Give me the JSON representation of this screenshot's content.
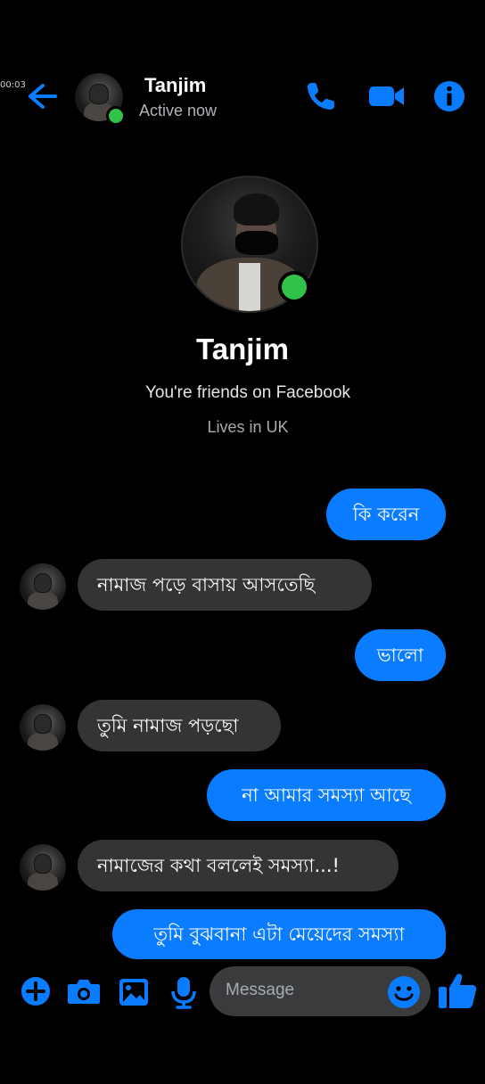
{
  "recording": {
    "timer": "00:03"
  },
  "header": {
    "name": "Tanjim",
    "status": "Active now",
    "icons": [
      "back-arrow-icon",
      "phone-icon",
      "video-camera-icon",
      "info-icon"
    ]
  },
  "profile": {
    "name": "Tanjim",
    "friends_text": "You're friends on Facebook",
    "lives_text": "Lives in UK"
  },
  "messages": [
    {
      "from": "me",
      "text": "কি করেন"
    },
    {
      "from": "them",
      "text": "নামাজ পড়ে বাসায় আসতেছি"
    },
    {
      "from": "me",
      "text": "ভালো"
    },
    {
      "from": "them",
      "text": "তুমি নামাজ পড়ছো"
    },
    {
      "from": "me",
      "text": "না আমার সমস্যা আছে"
    },
    {
      "from": "them",
      "text": "নামাজের কথা বললেই সমস্যা...!"
    },
    {
      "from": "me",
      "text": "তুমি বুঝবানা এটা মেয়েদের সমস্যা"
    }
  ],
  "composer": {
    "placeholder": "Message",
    "icons": [
      "plus-icon",
      "camera-icon",
      "gallery-icon",
      "microphone-icon",
      "emoji-icon",
      "like-icon"
    ]
  },
  "colors": {
    "background": "#000000",
    "accent": "#0a7cff",
    "incoming_bubble": "#333436",
    "online": "#31c24a"
  }
}
